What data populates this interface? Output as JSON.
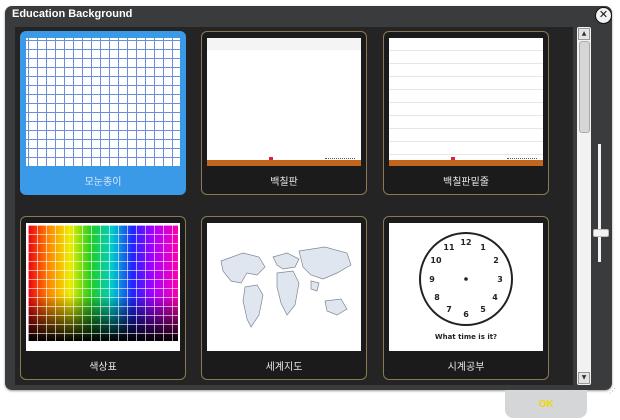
{
  "dialog": {
    "title": "Education Background",
    "close_symbol": "✕"
  },
  "backgrounds": [
    {
      "label": "모눈종이",
      "selected": true,
      "kind": "grid"
    },
    {
      "label": "백칠판",
      "selected": false,
      "kind": "whiteboard"
    },
    {
      "label": "백칠판밑줄",
      "selected": false,
      "kind": "lined-whiteboard"
    },
    {
      "label": "색상표",
      "selected": false,
      "kind": "color-chart"
    },
    {
      "label": "세계지도",
      "selected": false,
      "kind": "world-map"
    },
    {
      "label": "시계공부",
      "selected": false,
      "kind": "clock"
    }
  ],
  "clock": {
    "numbers": [
      "12",
      "1",
      "2",
      "3",
      "4",
      "5",
      "6",
      "7",
      "8",
      "9",
      "10",
      "11"
    ],
    "caption": "What time is it?"
  },
  "scrollbar": {
    "up_symbol": "▲",
    "down_symbol": "▼"
  },
  "ok_label": "OK",
  "colors": {
    "dialog_bg": "#3a3b3d",
    "selected_bg": "#3a9ae8",
    "tile_border": "#8a7a52",
    "ok_text": "#f1d700"
  }
}
